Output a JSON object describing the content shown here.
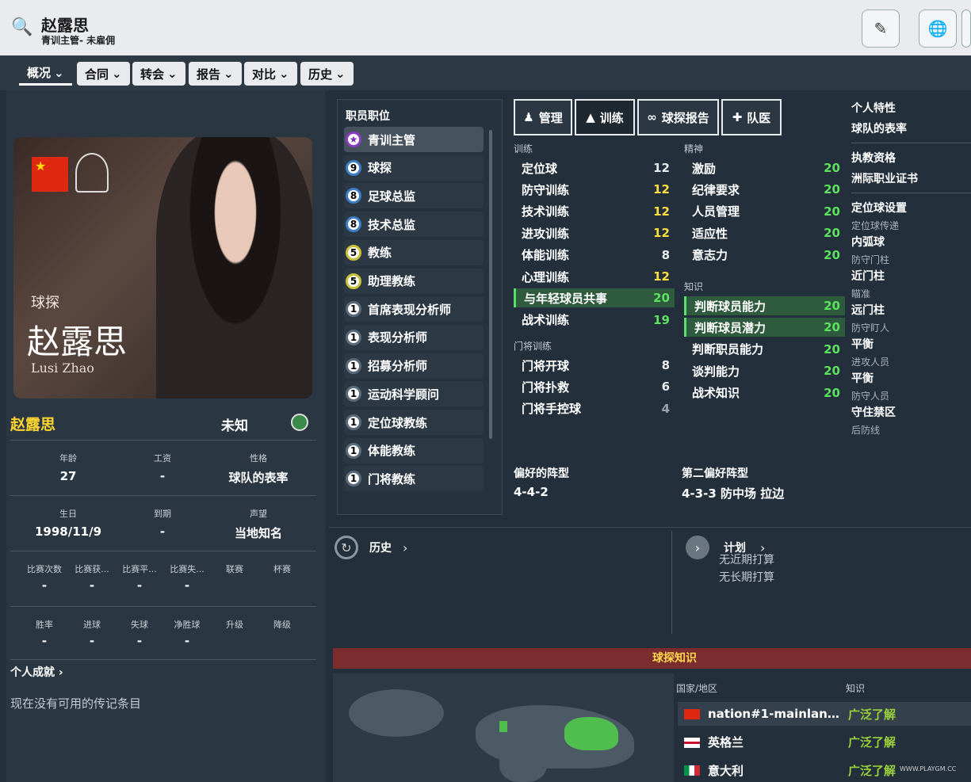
{
  "header": {
    "name": "赵露思",
    "subtitle": "青训主管- 未雇佣"
  },
  "tabs": [
    {
      "label": "概况"
    },
    {
      "label": "合同"
    },
    {
      "label": "转会"
    },
    {
      "label": "报告"
    },
    {
      "label": "对比"
    },
    {
      "label": "历史"
    }
  ],
  "profile": {
    "card_role": "球探",
    "card_name_cn": "赵露思",
    "card_name_en": "Lusi Zhao",
    "name": "赵露思",
    "status": "未知",
    "stats_row1": [
      {
        "label": "年龄",
        "value": "27"
      },
      {
        "label": "工资",
        "value": "-"
      },
      {
        "label": "性格",
        "value": "球队的表率"
      }
    ],
    "stats_row2": [
      {
        "label": "生日",
        "value": "1998/11/9"
      },
      {
        "label": "到期",
        "value": "-"
      },
      {
        "label": "声望",
        "value": "当地知名"
      }
    ],
    "stats_row3": [
      {
        "label": "比赛次数",
        "value": "-"
      },
      {
        "label": "比赛获...",
        "value": "-"
      },
      {
        "label": "比赛平...",
        "value": "-"
      },
      {
        "label": "比赛失...",
        "value": "-"
      },
      {
        "label": "联赛",
        "value": ""
      },
      {
        "label": "杯赛",
        "value": ""
      }
    ],
    "stats_row4": [
      {
        "label": "胜率",
        "value": "-"
      },
      {
        "label": "进球",
        "value": "-"
      },
      {
        "label": "失球",
        "value": "-"
      },
      {
        "label": "净胜球",
        "value": "-"
      },
      {
        "label": "升级",
        "value": ""
      },
      {
        "label": "降级",
        "value": ""
      }
    ],
    "achievements": "个人成就",
    "no_bio": "现在没有可用的传记条目"
  },
  "roles": {
    "title": "职员职位",
    "items": [
      {
        "badge": "★",
        "label": "青训主管"
      },
      {
        "badge": "9",
        "label": "球探"
      },
      {
        "badge": "8",
        "label": "足球总监"
      },
      {
        "badge": "8",
        "label": "技术总监"
      },
      {
        "badge": "5",
        "label": "教练"
      },
      {
        "badge": "5",
        "label": "助理教练"
      },
      {
        "badge": "1",
        "label": "首席表现分析师"
      },
      {
        "badge": "1",
        "label": "表现分析师"
      },
      {
        "badge": "1",
        "label": "招募分析师"
      },
      {
        "badge": "1",
        "label": "运动科学顾问"
      },
      {
        "badge": "1",
        "label": "定位球教练"
      },
      {
        "badge": "1",
        "label": "体能教练"
      },
      {
        "badge": "1",
        "label": "门将教练"
      }
    ]
  },
  "attr_tabs": [
    {
      "label": "管理"
    },
    {
      "label": "训练"
    },
    {
      "label": "球探报告"
    },
    {
      "label": "队医"
    }
  ],
  "training": {
    "title": "训练",
    "items": [
      {
        "label": "定位球",
        "value": "12",
        "color": "white"
      },
      {
        "label": "防守训练",
        "value": "12",
        "color": "yellow"
      },
      {
        "label": "技术训练",
        "value": "12",
        "color": "yellow"
      },
      {
        "label": "进攻训练",
        "value": "12",
        "color": "yellow"
      },
      {
        "label": "体能训练",
        "value": "8",
        "color": "white"
      },
      {
        "label": "心理训练",
        "value": "12",
        "color": "yellow"
      },
      {
        "label": "与年轻球员共事",
        "value": "20",
        "color": "green",
        "hl": true
      },
      {
        "label": "战术训练",
        "value": "19",
        "color": "green"
      }
    ]
  },
  "gk": {
    "title": "门将训练",
    "items": [
      {
        "label": "门将开球",
        "value": "8",
        "color": "white"
      },
      {
        "label": "门将扑救",
        "value": "6",
        "color": "white"
      },
      {
        "label": "门将手控球",
        "value": "4",
        "color": "gray"
      }
    ]
  },
  "mental": {
    "title": "精神",
    "items": [
      {
        "label": "激励",
        "value": "20",
        "color": "green"
      },
      {
        "label": "纪律要求",
        "value": "20",
        "color": "green"
      },
      {
        "label": "人员管理",
        "value": "20",
        "color": "green"
      },
      {
        "label": "适应性",
        "value": "20",
        "color": "green"
      },
      {
        "label": "意志力",
        "value": "20",
        "color": "green"
      }
    ]
  },
  "knowledge": {
    "title": "知识",
    "items": [
      {
        "label": "判断球员能力",
        "value": "20",
        "color": "green",
        "hl": true
      },
      {
        "label": "判断球员潜力",
        "value": "20",
        "color": "green",
        "hl": true
      },
      {
        "label": "判断职员能力",
        "value": "20",
        "color": "green"
      },
      {
        "label": "谈判能力",
        "value": "20",
        "color": "green"
      },
      {
        "label": "战术知识",
        "value": "20",
        "color": "green"
      }
    ]
  },
  "formation": {
    "pref_label": "偏好的阵型",
    "pref": "4-4-2",
    "second_label": "第二偏好阵型",
    "second": "4-3-3 防中场 拉边"
  },
  "right_side": {
    "trait_title": "个人特性",
    "trait": "球队的表率",
    "license_title": "执教资格",
    "license": "洲际职业证书",
    "setpiece_title": "定位球设置",
    "rows": [
      {
        "k": "定位球传递",
        "v": "内弧球"
      },
      {
        "k": "防守门柱",
        "v": "近门柱"
      },
      {
        "k": "瞄准",
        "v": "远门柱"
      },
      {
        "k": "防守盯人",
        "v": "平衡"
      },
      {
        "k": "进攻人员",
        "v": "平衡"
      },
      {
        "k": "防守人员",
        "v": "守住禁区"
      },
      {
        "k": "后防线",
        "v": ""
      }
    ]
  },
  "history": {
    "label": "历史"
  },
  "plans": {
    "label": "计划",
    "short": "无近期打算",
    "long": "无长期打算"
  },
  "scout": {
    "title": "球探知识",
    "col_country": "国家/地区",
    "col_know": "知识",
    "rows": [
      {
        "country": "nation#1-mainland_ch...",
        "know": "广泛了解"
      },
      {
        "country": "英格兰",
        "know": "广泛了解"
      },
      {
        "country": "意大利",
        "know": "广泛了解"
      }
    ]
  },
  "watermark": "WWW.PLAYGM.CC"
}
